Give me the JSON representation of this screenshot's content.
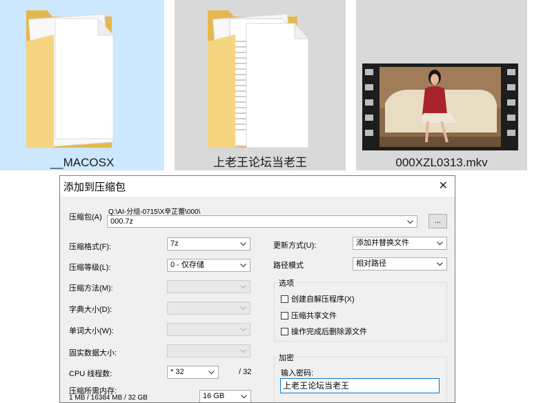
{
  "explorer": {
    "items": [
      {
        "name": "__MACOSX",
        "type": "folder",
        "selected": true
      },
      {
        "name": "上老王论坛当老王",
        "type": "folder",
        "selected": false
      },
      {
        "name": "000XZL0313.mkv",
        "type": "video",
        "selected": false
      }
    ]
  },
  "dialog": {
    "title": "添加到压缩包",
    "archive_label": "压缩包(A)",
    "archive_path": "Q:\\AI-分组-0715\\X辛芷蕾\\000\\",
    "archive_name": "000.7z",
    "browse_label": "...",
    "left": {
      "format_label": "压缩格式(F):",
      "format_value": "7z",
      "level_label": "压缩等级(L):",
      "level_value": "0 - 仅存储",
      "method_label": "压缩方法(M):",
      "method_value": "",
      "dict_label": "字典大小(D):",
      "dict_value": "",
      "word_label": "单词大小(W):",
      "word_value": "",
      "solid_label": "固实数据大小:",
      "solid_value": "",
      "cpu_label": "CPU 线程数:",
      "cpu_value": "* 32",
      "cpu_max": "/ 32",
      "memory_label": "压缩所需内存:",
      "memory_detail": "1 MB / 16384 MB / 32 GB",
      "memory_value": "16 GB"
    },
    "right": {
      "update_label": "更新方式(U):",
      "update_value": "添加并替换文件",
      "path_label": "路径模式",
      "path_value": "相对路径",
      "options_title": "选项",
      "opt_sfx": "创建自解压程序(X)",
      "opt_shared": "压缩共享文件",
      "opt_delete": "操作完成后删除源文件",
      "enc_title": "加密",
      "pwd_label": "输入密码:",
      "pwd_value": "上老王论坛当老王"
    }
  }
}
